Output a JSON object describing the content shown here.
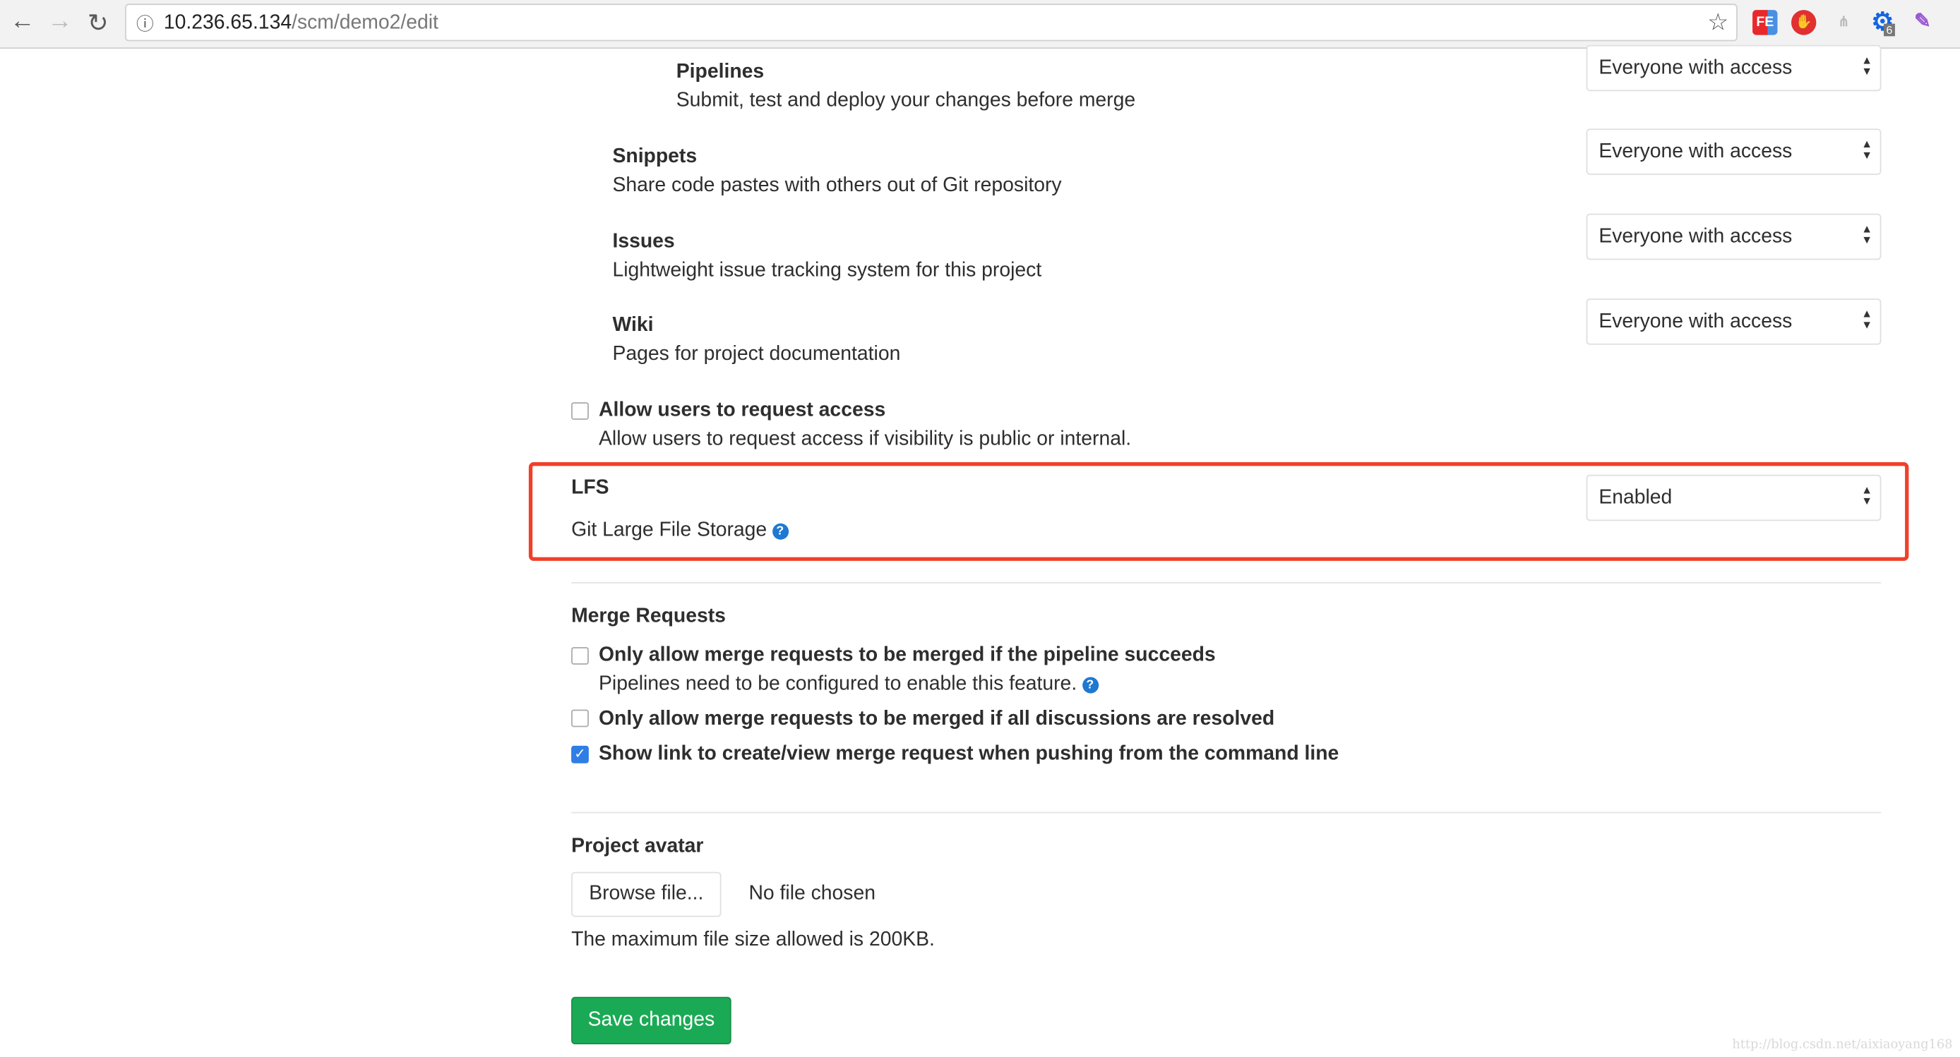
{
  "browser": {
    "url_host": "10.236.65.134",
    "url_path": "/scm/demo2/edit",
    "extensions": [
      "fe-helper",
      "adblock",
      "sitemap",
      "gear-extension",
      "feather-pen"
    ],
    "gear_badge": "6"
  },
  "features": [
    {
      "title": "Pipelines",
      "desc": "Submit, test and deploy your changes before merge",
      "value": "Everyone with access"
    },
    {
      "title": "Snippets",
      "desc": "Share code pastes with others out of Git repository",
      "value": "Everyone with access"
    },
    {
      "title": "Issues",
      "desc": "Lightweight issue tracking system for this project",
      "value": "Everyone with access"
    },
    {
      "title": "Wiki",
      "desc": "Pages for project documentation",
      "value": "Everyone with access"
    }
  ],
  "request_access": {
    "label": "Allow users to request access",
    "desc": "Allow users to request access if visibility is public or internal.",
    "checked": false
  },
  "lfs": {
    "title": "LFS",
    "desc": "Git Large File Storage",
    "value": "Enabled",
    "highlight_color": "#f0402a"
  },
  "merge_requests": {
    "title": "Merge Requests",
    "options": [
      {
        "label": "Only allow merge requests to be merged if the pipeline succeeds",
        "desc": "Pipelines need to be configured to enable this feature.",
        "checked": false
      },
      {
        "label": "Only allow merge requests to be merged if all discussions are resolved",
        "checked": false
      },
      {
        "label": "Show link to create/view merge request when pushing from the command line",
        "checked": true
      }
    ]
  },
  "avatar": {
    "title": "Project avatar",
    "browse_label": "Browse file...",
    "file_status": "No file chosen",
    "note": "The maximum file size allowed is 200KB."
  },
  "save_label": "Save changes",
  "watermark": "http://blog.csdn.net/aixiaoyang168",
  "colors": {
    "save": "#1aaa55",
    "checkbox": "#2f7ee6",
    "help": "#1f78d1"
  }
}
